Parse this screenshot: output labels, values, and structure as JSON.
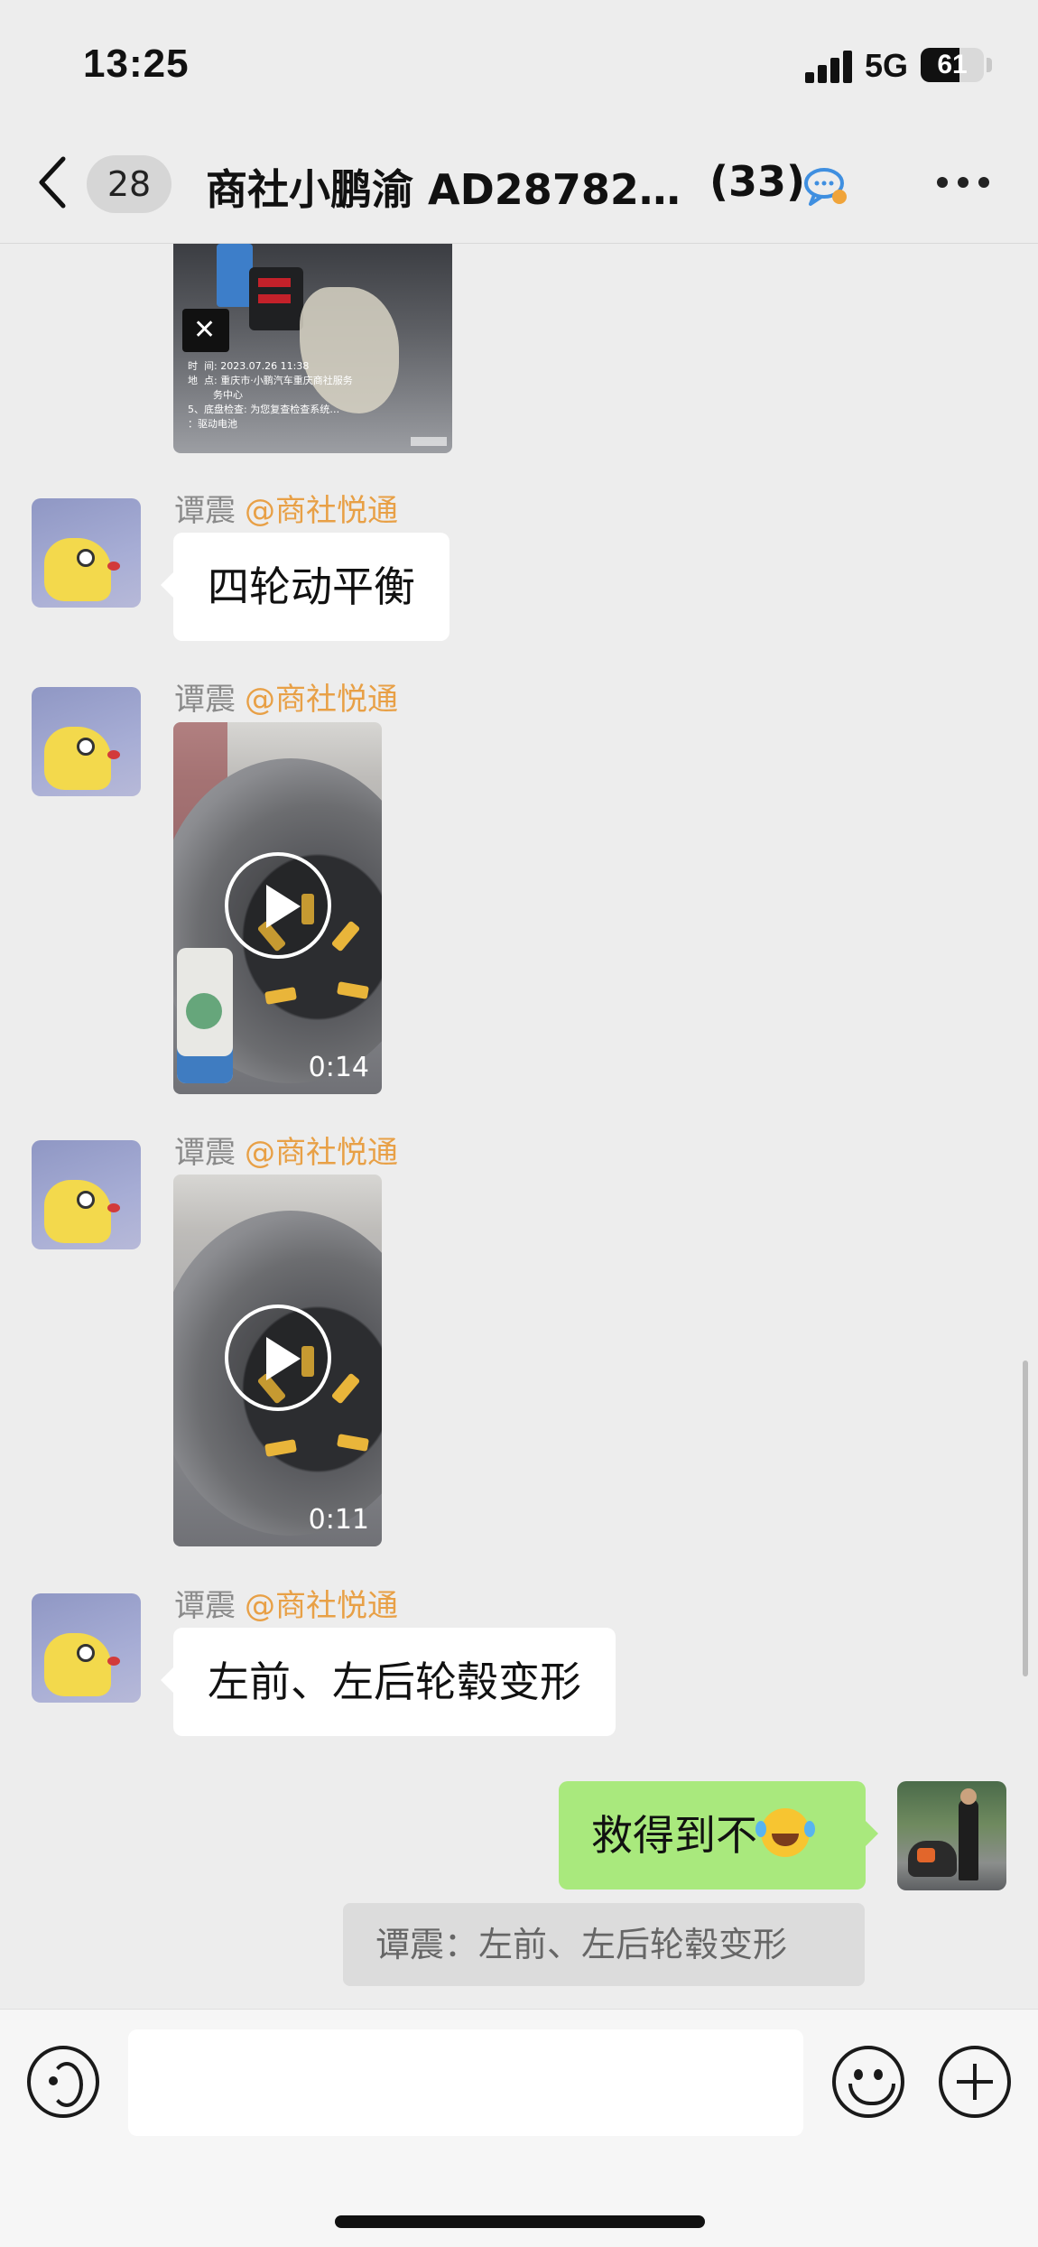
{
  "status_bar": {
    "time": "13:25",
    "network": "5G",
    "battery_level": "61",
    "battery_fraction": 0.61
  },
  "nav": {
    "unread_count": "28",
    "title": "商社小鹏渝 AD28782…",
    "member_count": "(33)"
  },
  "messages": [
    {
      "type": "image",
      "caption": "时  间: 2023.07.26 11:38\n地  点: 重庆市·小鹏汽车重庆商社服务\n        务中心\n5、底盘检查: 为您复查检查系统…\n：驱动电池"
    },
    {
      "type": "text",
      "sender": "谭震",
      "mention": "@商社悦通",
      "text": "四轮动平衡"
    },
    {
      "type": "video",
      "sender": "谭震",
      "mention": "@商社悦通",
      "duration": "0:14"
    },
    {
      "type": "video",
      "sender": "谭震",
      "mention": "@商社悦通",
      "duration": "0:11"
    },
    {
      "type": "text",
      "sender": "谭震",
      "mention": "@商社悦通",
      "text": "左前、左后轮毂变形"
    },
    {
      "type": "self",
      "text": "救得到不",
      "emoji": "face-with-tears-of-joy",
      "quote": "谭震：左前、左后轮毂变形"
    }
  ],
  "input": {
    "placeholder": ""
  },
  "icons": {
    "back": "chevron-left-icon",
    "chat": "chat-bubble-icon",
    "more": "more-dots-icon",
    "voice": "voice-icon",
    "emoji": "emoji-icon",
    "plus": "plus-icon"
  },
  "colors": {
    "background": "#ededed",
    "self_bubble": "#a9e97d",
    "other_bubble": "#ffffff",
    "mention": "#e8a046",
    "sender": "#8a8a8a"
  }
}
